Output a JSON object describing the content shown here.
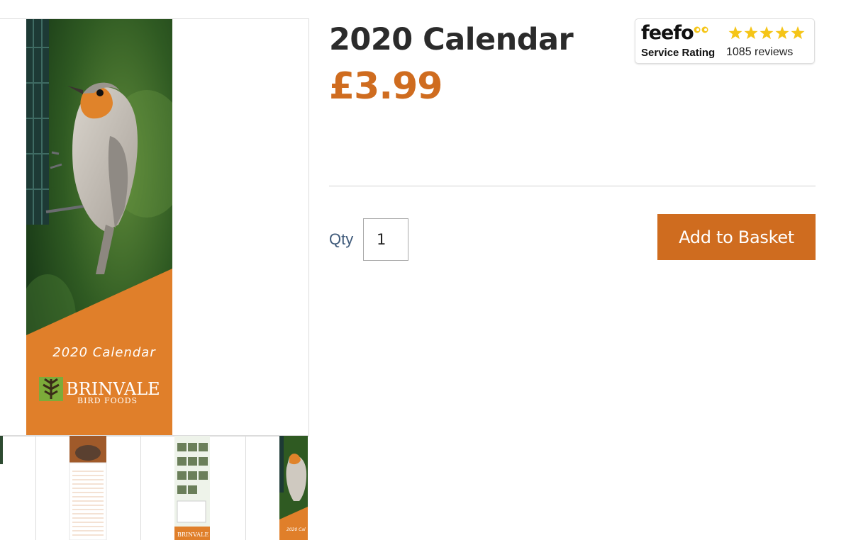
{
  "product": {
    "title": "2020 Calendar",
    "price": "£3.99"
  },
  "feefo": {
    "logo_text": "feefo",
    "service_rating_label": "Service Rating",
    "reviews_text": "1085 reviews",
    "rating_stars": 5,
    "star_color": "#f5c518"
  },
  "purchase": {
    "qty_label": "Qty",
    "qty_value": "1",
    "add_to_basket_label": "Add to Basket"
  },
  "gallery": {
    "cover_title": "2020 Calendar",
    "brand_name": "BRINVALE",
    "brand_sub": "BIRD FOODS",
    "thumb_brand": "BRINVALE",
    "thumb_cover_title": "2020 Cal"
  },
  "colors": {
    "accent": "#cf6c1f",
    "qty_label": "#3f5a7a",
    "calendar_orange": "#e07f2a"
  }
}
